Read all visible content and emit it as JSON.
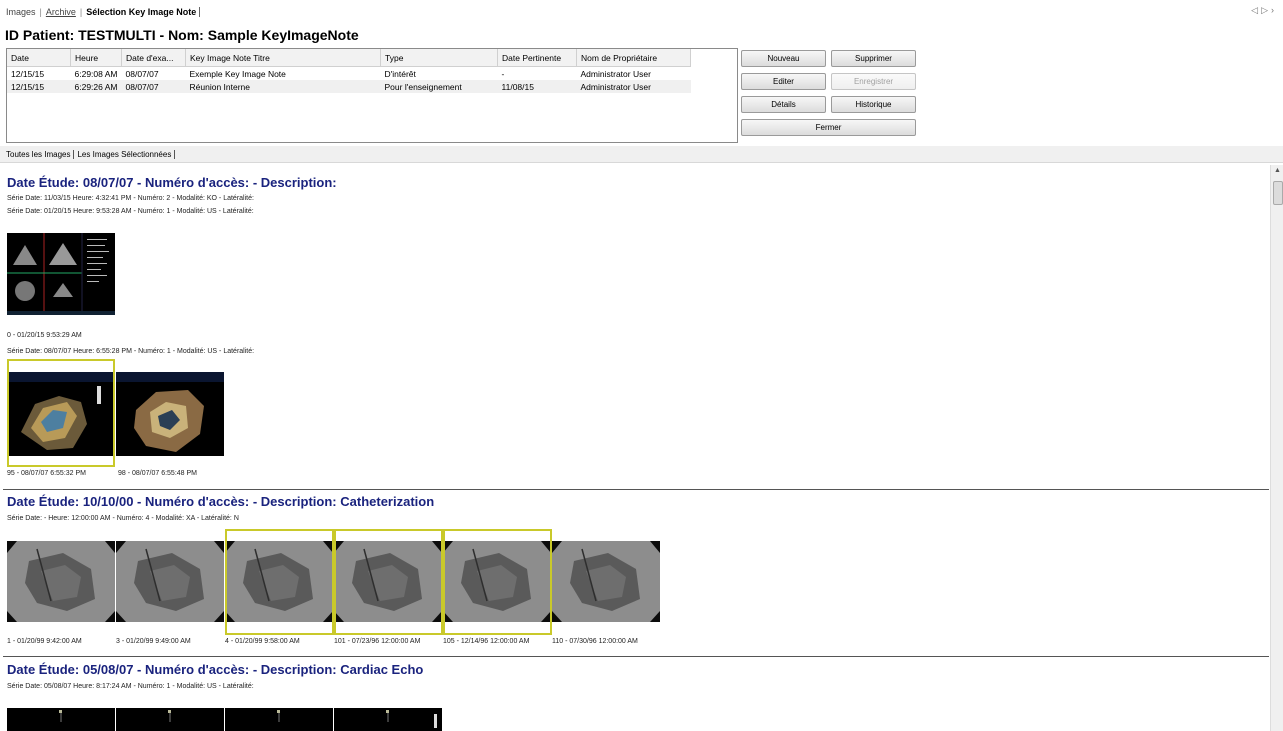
{
  "top_tabs": [
    "Images",
    "Archive",
    "Sélection Key Image Note"
  ],
  "page_title": "ID Patient: TESTMULTI - Nom: Sample KeyImageNote",
  "grid": {
    "columns": [
      "Date",
      "Heure",
      "Date d'exa...",
      "Key Image Note Titre",
      "Type",
      "Date Pertinente",
      "Nom de Propriétaire"
    ],
    "rows": [
      [
        "12/15/15",
        "6:29:08 AM",
        "08/07/07",
        "Exemple Key Image Note",
        "D'intérêt",
        "-",
        "Administrator User"
      ],
      [
        "12/15/15",
        "6:29:26 AM",
        "08/07/07",
        "Réunion Interne",
        "Pour l'enseignement",
        "11/08/15",
        "Administrator User"
      ]
    ]
  },
  "buttons": {
    "nouveau": "Nouveau",
    "supprimer": "Supprimer",
    "editer": "Editer",
    "enregistrer": "Enregistrer",
    "details": "Détails",
    "historique": "Historique",
    "fermer": "Fermer"
  },
  "sub_tabs": [
    "Toutes les Images",
    "Les Images Sélectionnées"
  ],
  "studies": [
    {
      "title": "Date Étude: 08/07/07 - Numéro d'accès:  - Description:",
      "series": [
        "Série Date: 11/03/15 Heure: 4:32:41 PM - Numéro: 2 - Modalité: KO - Latéralité:",
        "Série Date: 01/20/15 Heure: 9:53:28 AM - Numéro: 1 - Modalité: US - Latéralité:"
      ],
      "caption_1": "0 - 01/20/15 9:53:29 AM",
      "series_3": "Série Date: 08/07/07 Heure: 6:55:28 PM - Numéro: 1 - Modalité: US - Latéralité:",
      "captions_2": [
        "95 - 08/07/07 6:55:32 PM",
        "98 - 08/07/07 6:55:48 PM"
      ]
    },
    {
      "title": "Date Étude: 10/10/00 - Numéro d'accès:  - Description: Catheterization",
      "series": [
        "Série Date:  - Heure: 12:00:00 AM - Numéro: 4 - Modalité: XA - Latéralité: N"
      ],
      "captions": [
        "1 - 01/20/99 9:42:00 AM",
        "3 - 01/20/99 9:49:00 AM",
        "4 - 01/20/99 9:58:00 AM",
        "101 - 07/23/96 12:00:00 AM",
        "105 - 12/14/96 12:00:00 AM",
        "110 - 07/30/96 12:00:00 AM"
      ],
      "selected": [
        false,
        false,
        true,
        true,
        true,
        false
      ]
    },
    {
      "title": "Date Étude: 05/08/07 - Numéro d'accès:  - Description: Cardiac Echo",
      "series": [
        "Série Date: 05/08/07 Heure: 8:17:24 AM - Numéro: 1 - Modalité: US - Latéralité:"
      ]
    }
  ],
  "colors": {
    "study_title": "#1a237e",
    "selection": "#c9c92a"
  }
}
